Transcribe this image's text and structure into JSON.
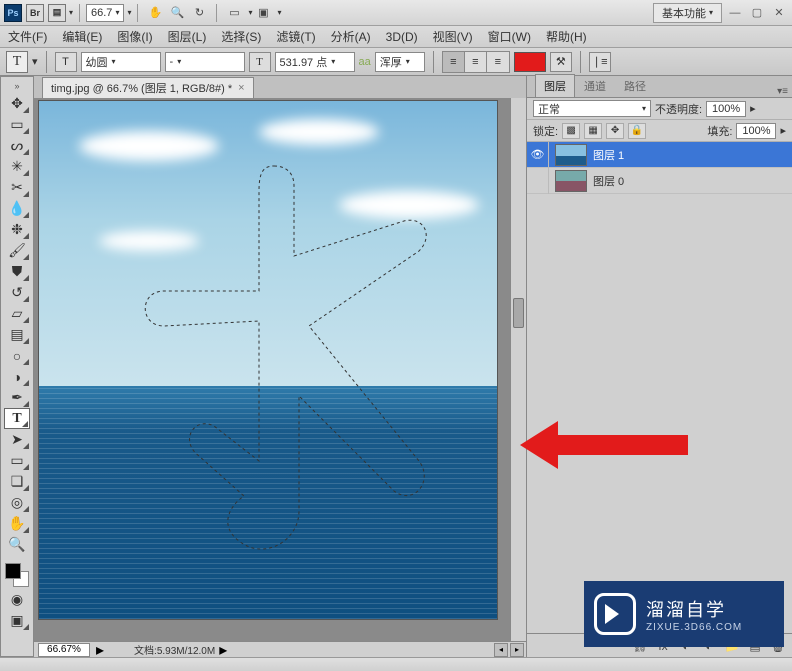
{
  "appbar": {
    "ps": "Ps",
    "br": "Br",
    "zoom": "66.7",
    "workspace_label": "基本功能"
  },
  "menu": {
    "file": "文件(F)",
    "edit": "编辑(E)",
    "image": "图像(I)",
    "layer": "图层(L)",
    "select": "选择(S)",
    "filter": "滤镜(T)",
    "analysis": "分析(A)",
    "threeD": "3D(D)",
    "view": "视图(V)",
    "window": "窗口(W)",
    "help": "帮助(H)"
  },
  "options": {
    "font": "幼圆",
    "style": "-",
    "size": "531.97 点",
    "aa": "浑厚",
    "t_btn": "T",
    "tt_btn": "T",
    "aa_label": "aa",
    "swatch_color": "#e21b1b"
  },
  "doc": {
    "tab_title": "timg.jpg @ 66.7% (图层 1, RGB/8#) *",
    "zoom_field": "66.67%",
    "docinfo_label": "文档:",
    "docinfo_value": "5.93M/12.0M"
  },
  "panel": {
    "tab_layers": "图层",
    "tab_channels": "通道",
    "tab_paths": "路径",
    "blend_mode": "正常",
    "opacity_label": "不透明度:",
    "opacity_value": "100%",
    "lock_label": "锁定:",
    "fill_label": "填充:",
    "fill_value": "100%",
    "layers": [
      {
        "name": "图层 1",
        "visible": true
      },
      {
        "name": "图层 0",
        "visible": false
      }
    ]
  },
  "watermark": {
    "big": "溜溜自学",
    "small": "ZIXUE.3D66.COM"
  },
  "icons": {
    "hand": "✋",
    "zoom": "🔍",
    "rotate": "↻",
    "screen1": "▭",
    "screen2": "▣",
    "dropdown": "▾",
    "right_tri": "▸",
    "left_tri": "◂",
    "eye": "👁",
    "chain": "⛓",
    "fx": "fx",
    "mask": "◐",
    "folder": "📁",
    "new": "▤",
    "trash": "🗑",
    "lock_px": "▦",
    "lock_pos": "✥",
    "lock_all": "🔒",
    "lock_trans": "▩",
    "align_l": "≡",
    "align_c": "≡",
    "align_r": "≡",
    "warp": "⚒",
    "toggle": "↧",
    "commit": "✓"
  }
}
